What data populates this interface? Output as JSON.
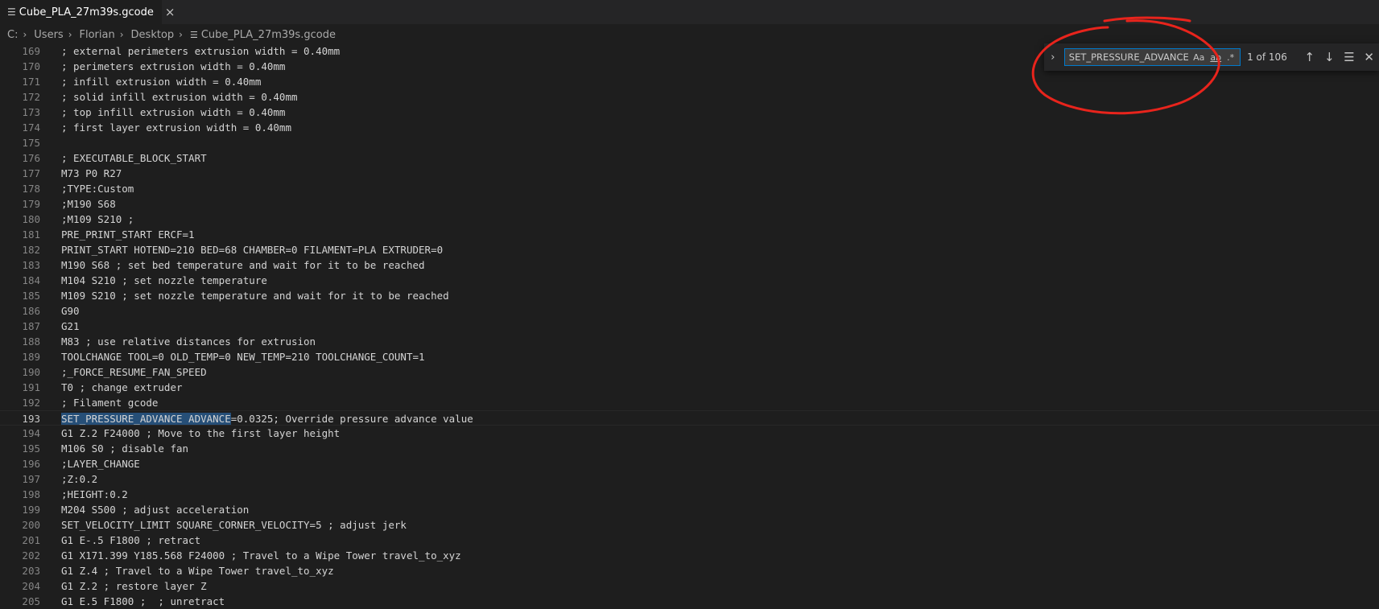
{
  "tab": {
    "label": "Cube_PLA_27m39s.gcode",
    "icon": "lines-file-icon",
    "close_icon": "×"
  },
  "breadcrumb": {
    "items": [
      "C:",
      "Users",
      "Florian",
      "Desktop"
    ],
    "file": "Cube_PLA_27m39s.gcode"
  },
  "editor": {
    "lines": [
      {
        "num": "169",
        "text": "; external perimeters extrusion width = 0.40mm"
      },
      {
        "num": "170",
        "text": "; perimeters extrusion width = 0.40mm"
      },
      {
        "num": "171",
        "text": "; infill extrusion width = 0.40mm"
      },
      {
        "num": "172",
        "text": "; solid infill extrusion width = 0.40mm"
      },
      {
        "num": "173",
        "text": "; top infill extrusion width = 0.40mm"
      },
      {
        "num": "174",
        "text": "; first layer extrusion width = 0.40mm"
      },
      {
        "num": "175",
        "text": ""
      },
      {
        "num": "176",
        "text": "; EXECUTABLE_BLOCK_START"
      },
      {
        "num": "177",
        "text": "M73 P0 R27"
      },
      {
        "num": "178",
        "text": ";TYPE:Custom"
      },
      {
        "num": "179",
        "text": ";M190 S68"
      },
      {
        "num": "180",
        "text": ";M109 S210 ;"
      },
      {
        "num": "181",
        "text": "PRE_PRINT_START ERCF=1"
      },
      {
        "num": "182",
        "text": "PRINT_START HOTEND=210 BED=68 CHAMBER=0 FILAMENT=PLA EXTRUDER=0"
      },
      {
        "num": "183",
        "text": "M190 S68 ; set bed temperature and wait for it to be reached"
      },
      {
        "num": "184",
        "text": "M104 S210 ; set nozzle temperature"
      },
      {
        "num": "185",
        "text": "M109 S210 ; set nozzle temperature and wait for it to be reached"
      },
      {
        "num": "186",
        "text": "G90"
      },
      {
        "num": "187",
        "text": "G21"
      },
      {
        "num": "188",
        "text": "M83 ; use relative distances for extrusion"
      },
      {
        "num": "189",
        "text": "TOOLCHANGE TOOL=0 OLD_TEMP=0 NEW_TEMP=210 TOOLCHANGE_COUNT=1"
      },
      {
        "num": "190",
        "text": ";_FORCE_RESUME_FAN_SPEED"
      },
      {
        "num": "191",
        "text": "T0 ; change extruder"
      },
      {
        "num": "192",
        "text": "; Filament gcode"
      },
      {
        "num": "193",
        "match": "SET_PRESSURE_ADVANCE ADVANCE",
        "text": "=0.0325; Override pressure advance value"
      },
      {
        "num": "194",
        "text": "G1 Z.2 F24000 ; Move to the first layer height"
      },
      {
        "num": "195",
        "text": "M106 S0 ; disable fan"
      },
      {
        "num": "196",
        "text": ";LAYER_CHANGE"
      },
      {
        "num": "197",
        "text": ";Z:0.2"
      },
      {
        "num": "198",
        "text": ";HEIGHT:0.2"
      },
      {
        "num": "199",
        "text": "M204 S500 ; adjust acceleration"
      },
      {
        "num": "200",
        "text": "SET_VELOCITY_LIMIT SQUARE_CORNER_VELOCITY=5 ; adjust jerk"
      },
      {
        "num": "201",
        "text": "G1 E-.5 F1800 ; retract"
      },
      {
        "num": "202",
        "text": "G1 X171.399 Y185.568 F24000 ; Travel to a Wipe Tower travel_to_xyz"
      },
      {
        "num": "203",
        "text": "G1 Z.4 ; Travel to a Wipe Tower travel_to_xyz"
      },
      {
        "num": "204",
        "text": "G1 Z.2 ; restore layer Z"
      },
      {
        "num": "205",
        "text": "G1 E.5 F1800 ;  ; unretract"
      }
    ]
  },
  "find": {
    "query": "SET_PRESSURE_ADVANCE",
    "match_case": "Aa",
    "whole_word": "ab",
    "regex": ".*",
    "count": "1 of 106",
    "toggle_icon": "chevron-right-icon",
    "prev_icon": "arrow-up-icon",
    "next_icon": "arrow-down-icon",
    "selection_icon": "find-in-selection-icon",
    "close_icon": "close-icon"
  },
  "colors": {
    "highlight": "#264f78",
    "annotation": "#e8241c",
    "focus_border": "#007acc"
  }
}
